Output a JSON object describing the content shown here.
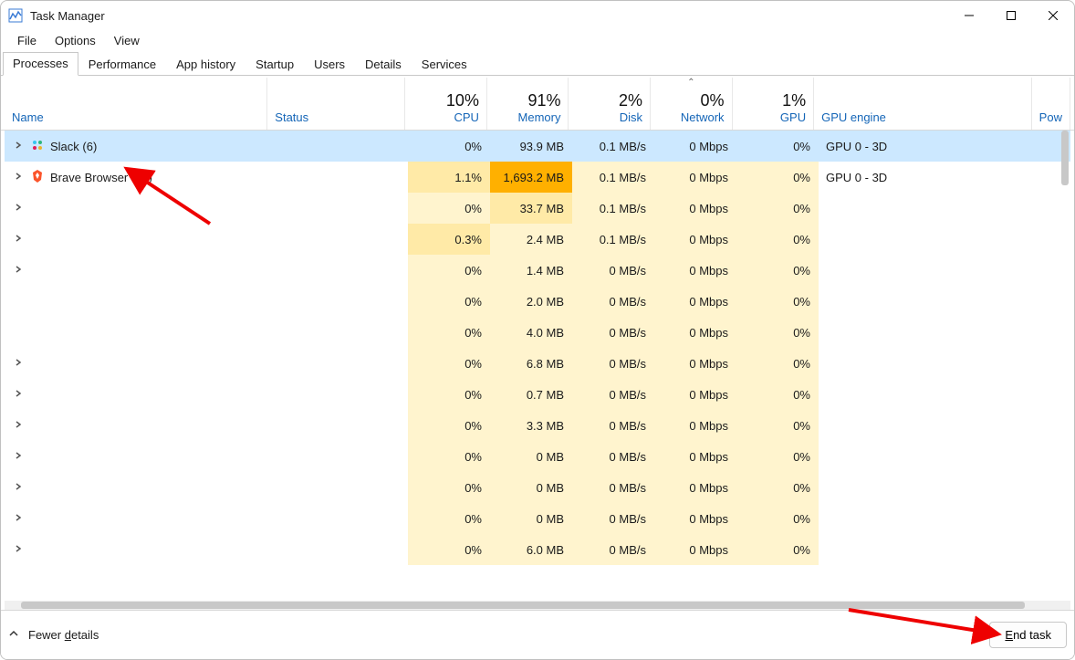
{
  "window": {
    "title": "Task Manager"
  },
  "menu": {
    "file": "File",
    "options": "Options",
    "view": "View"
  },
  "tabs": {
    "processes": "Processes",
    "performance": "Performance",
    "app_history": "App history",
    "startup": "Startup",
    "users": "Users",
    "details": "Details",
    "services": "Services"
  },
  "columns": {
    "name": "Name",
    "status": "Status",
    "cpu_pct": "10%",
    "cpu_lbl": "CPU",
    "mem_pct": "91%",
    "mem_lbl": "Memory",
    "disk_pct": "2%",
    "disk_lbl": "Disk",
    "net_pct": "0%",
    "net_lbl": "Network",
    "gpu_pct": "1%",
    "gpu_lbl": "GPU",
    "gpu_engine": "GPU engine",
    "power": "Pow"
  },
  "rows": [
    {
      "name": "Slack (6)",
      "icon": "slack",
      "chevron": true,
      "selected": true,
      "cpu": "0%",
      "mem": "93.9 MB",
      "disk": "0.1 MB/s",
      "net": "0 Mbps",
      "gpu": "0%",
      "gpu_engine": "GPU 0 - 3D",
      "heat": {
        "cpu": 0,
        "mem": 1,
        "disk": 1,
        "net": 1,
        "gpu": 1
      }
    },
    {
      "name": "Brave Browser (20)",
      "icon": "brave",
      "chevron": true,
      "cpu": "1.1%",
      "mem": "1,693.2 MB",
      "disk": "0.1 MB/s",
      "net": "0 Mbps",
      "gpu": "0%",
      "gpu_engine": "GPU 0 - 3D",
      "heat": {
        "cpu": 2,
        "mem": 5,
        "disk": 1,
        "net": 1,
        "gpu": 1
      }
    },
    {
      "name": "",
      "chevron": true,
      "blur": true,
      "cpu": "0%",
      "mem": "33.7 MB",
      "disk": "0.1 MB/s",
      "net": "0 Mbps",
      "gpu": "0%",
      "heat": {
        "cpu": 1,
        "mem": 2,
        "disk": 1,
        "net": 1,
        "gpu": 1
      }
    },
    {
      "name": "",
      "chevron": true,
      "blur": true,
      "cpu": "0.3%",
      "mem": "2.4 MB",
      "disk": "0.1 MB/s",
      "net": "0 Mbps",
      "gpu": "0%",
      "heat": {
        "cpu": 2,
        "mem": 1,
        "disk": 1,
        "net": 1,
        "gpu": 1
      }
    },
    {
      "name": "",
      "chevron": true,
      "blur": true,
      "cpu": "0%",
      "mem": "1.4 MB",
      "disk": "0 MB/s",
      "net": "0 Mbps",
      "gpu": "0%",
      "heat": {
        "cpu": 1,
        "mem": 1,
        "disk": 1,
        "net": 1,
        "gpu": 1
      }
    },
    {
      "name": "",
      "chevron": false,
      "blur": true,
      "cpu": "0%",
      "mem": "2.0 MB",
      "disk": "0 MB/s",
      "net": "0 Mbps",
      "gpu": "0%",
      "heat": {
        "cpu": 1,
        "mem": 1,
        "disk": 1,
        "net": 1,
        "gpu": 1
      }
    },
    {
      "name": "",
      "chevron": false,
      "blur": true,
      "cpu": "0%",
      "mem": "4.0 MB",
      "disk": "0 MB/s",
      "net": "0 Mbps",
      "gpu": "0%",
      "heat": {
        "cpu": 1,
        "mem": 1,
        "disk": 1,
        "net": 1,
        "gpu": 1
      }
    },
    {
      "name": "",
      "chevron": true,
      "blur": true,
      "cpu": "0%",
      "mem": "6.8 MB",
      "disk": "0 MB/s",
      "net": "0 Mbps",
      "gpu": "0%",
      "heat": {
        "cpu": 1,
        "mem": 1,
        "disk": 1,
        "net": 1,
        "gpu": 1
      }
    },
    {
      "name": "",
      "chevron": true,
      "blur": true,
      "cpu": "0%",
      "mem": "0.7 MB",
      "disk": "0 MB/s",
      "net": "0 Mbps",
      "gpu": "0%",
      "heat": {
        "cpu": 1,
        "mem": 1,
        "disk": 1,
        "net": 1,
        "gpu": 1
      }
    },
    {
      "name": "",
      "chevron": true,
      "blur": true,
      "cpu": "0%",
      "mem": "3.3 MB",
      "disk": "0 MB/s",
      "net": "0 Mbps",
      "gpu": "0%",
      "heat": {
        "cpu": 1,
        "mem": 1,
        "disk": 1,
        "net": 1,
        "gpu": 1
      }
    },
    {
      "name": "",
      "chevron": true,
      "blur": true,
      "cpu": "0%",
      "mem": "0 MB",
      "disk": "0 MB/s",
      "net": "0 Mbps",
      "gpu": "0%",
      "heat": {
        "cpu": 1,
        "mem": 1,
        "disk": 1,
        "net": 1,
        "gpu": 1
      }
    },
    {
      "name": "",
      "chevron": true,
      "blur": true,
      "cpu": "0%",
      "mem": "0 MB",
      "disk": "0 MB/s",
      "net": "0 Mbps",
      "gpu": "0%",
      "heat": {
        "cpu": 1,
        "mem": 1,
        "disk": 1,
        "net": 1,
        "gpu": 1
      }
    },
    {
      "name": "",
      "chevron": true,
      "blur": true,
      "cpu": "0%",
      "mem": "0 MB",
      "disk": "0 MB/s",
      "net": "0 Mbps",
      "gpu": "0%",
      "heat": {
        "cpu": 1,
        "mem": 1,
        "disk": 1,
        "net": 1,
        "gpu": 1
      }
    },
    {
      "name": "",
      "chevron": true,
      "blur": true,
      "cpu": "0%",
      "mem": "6.0 MB",
      "disk": "0 MB/s",
      "net": "0 Mbps",
      "gpu": "0%",
      "heat": {
        "cpu": 1,
        "mem": 1,
        "disk": 1,
        "net": 1,
        "gpu": 1
      }
    }
  ],
  "footer": {
    "fewer_details": "Fewer details",
    "end_task": "End task"
  }
}
